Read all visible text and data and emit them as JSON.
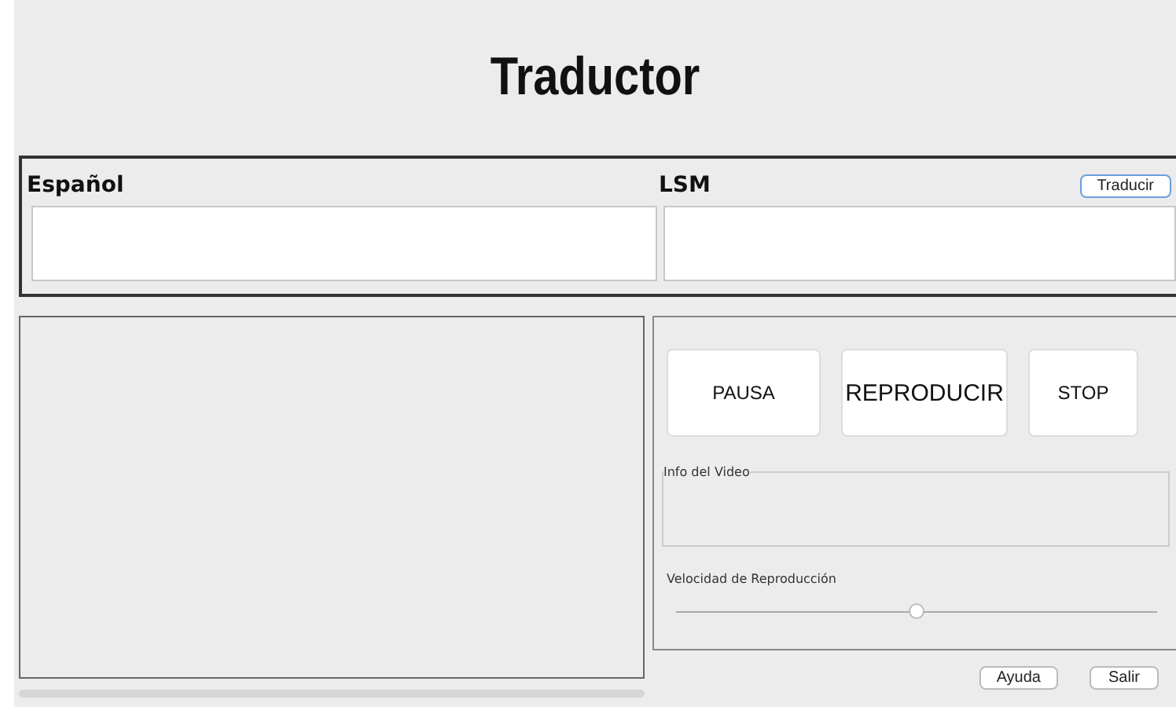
{
  "title": "Traductor",
  "translate": {
    "source_label": "Español",
    "target_label": "LSM",
    "button": "Traducir"
  },
  "controls": [
    {
      "label": "PAUSA",
      "kind": "small"
    },
    {
      "label": "REPRODUCIR",
      "kind": "large"
    },
    {
      "label": "STOP",
      "kind": "small"
    }
  ],
  "video_info": {
    "legend": "Info del Video"
  },
  "speed": {
    "label": "Velocidad de Reproducción",
    "level": 0.5
  },
  "footer_buttons": [
    "Ayuda",
    "Salir"
  ]
}
